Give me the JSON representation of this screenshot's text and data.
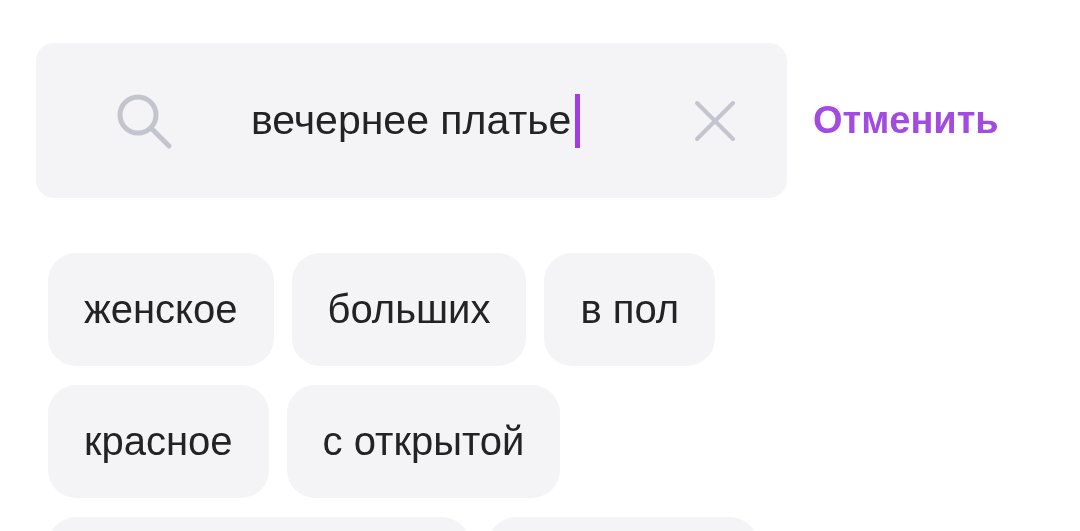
{
  "search": {
    "value": "вечернее платье",
    "focused": true
  },
  "cancel": "Отменить",
  "suggestions": [
    {
      "label": "женское"
    },
    {
      "label": "больших"
    },
    {
      "label": "в пол"
    },
    {
      "label": "красное"
    },
    {
      "label": "с открытой"
    }
  ],
  "cut_off_suggestions": [
    {
      "kind": "chip"
    },
    {
      "kind": "chip"
    }
  ]
}
